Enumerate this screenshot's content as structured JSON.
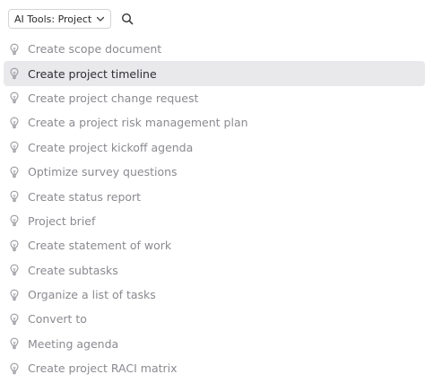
{
  "toolbar": {
    "dropdown_label": "AI Tools: Project",
    "dropdown_icon": "chevron-down-icon",
    "search_icon": "search-icon"
  },
  "colors": {
    "active_row_bg": "#e9e9ec",
    "label_muted": "#8a8a90",
    "label_active": "#2e2e33",
    "icon": "#9a9aa0"
  },
  "items": [
    {
      "label": "Create scope document",
      "icon": "lightbulb-icon",
      "active": false
    },
    {
      "label": "Create project timeline",
      "icon": "lightbulb-icon",
      "active": true
    },
    {
      "label": "Create project change request",
      "icon": "lightbulb-icon",
      "active": false
    },
    {
      "label": "Create a project risk management plan",
      "icon": "lightbulb-icon",
      "active": false
    },
    {
      "label": "Create project kickoff agenda",
      "icon": "lightbulb-icon",
      "active": false
    },
    {
      "label": "Optimize survey questions",
      "icon": "lightbulb-icon",
      "active": false
    },
    {
      "label": "Create status report",
      "icon": "lightbulb-icon",
      "active": false
    },
    {
      "label": "Project brief",
      "icon": "lightbulb-icon",
      "active": false
    },
    {
      "label": "Create statement of work",
      "icon": "lightbulb-icon",
      "active": false
    },
    {
      "label": "Create subtasks",
      "icon": "lightbulb-icon",
      "active": false
    },
    {
      "label": "Organize a list of tasks",
      "icon": "lightbulb-icon",
      "active": false
    },
    {
      "label": "Convert to",
      "icon": "lightbulb-icon",
      "active": false
    },
    {
      "label": "Meeting agenda",
      "icon": "lightbulb-icon",
      "active": false
    },
    {
      "label": "Create project RACI matrix",
      "icon": "lightbulb-icon",
      "active": false
    }
  ]
}
